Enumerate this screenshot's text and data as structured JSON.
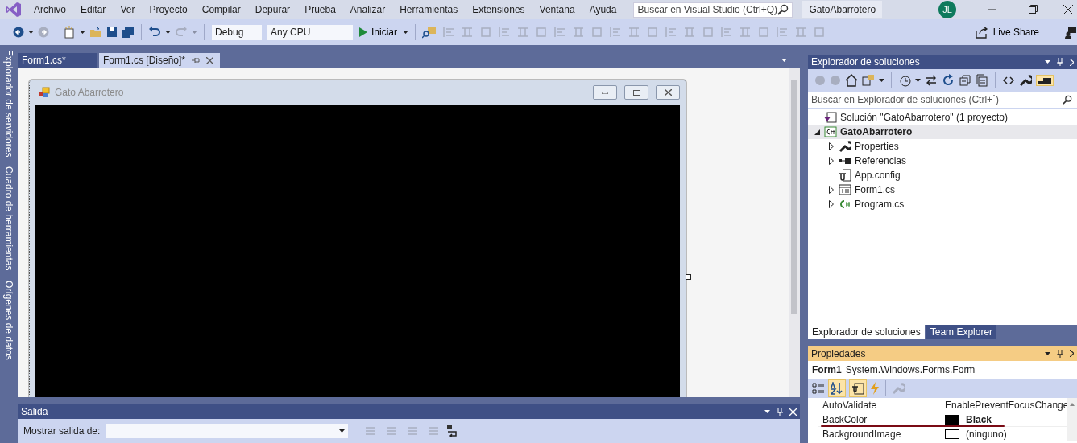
{
  "menu": [
    "Archivo",
    "Editar",
    "Ver",
    "Proyecto",
    "Compilar",
    "Depurar",
    "Prueba",
    "Analizar",
    "Herramientas",
    "Extensiones",
    "Ventana",
    "Ayuda"
  ],
  "search": {
    "placeholder": "Buscar en Visual Studio (Ctrl+Q)"
  },
  "project_title": "GatoAbarrotero",
  "avatar": "JL",
  "toolbar": {
    "configuration": "Debug",
    "platform": "Any CPU",
    "start": "Iniciar",
    "live_share": "Live Share"
  },
  "side_tabs": [
    "Explorador de servidores",
    "Cuadro de herramientas",
    "Orígenes de datos"
  ],
  "doc_tabs": [
    {
      "label": "Form1.cs*",
      "selected": false
    },
    {
      "label": "Form1.cs [Diseño]*",
      "selected": true
    }
  ],
  "designer": {
    "form_title": "Gato Abarrotero",
    "color": "#000000"
  },
  "output": {
    "title": "Salida",
    "show_label": "Mostrar salida de:"
  },
  "solution_explorer": {
    "title": "Explorador de soluciones",
    "search_placeholder": "Buscar en Explorador de soluciones (Ctrl+´)",
    "preview_selected": true,
    "tree": [
      {
        "label": "Solución \"GatoAbarrotero\"  (1 proyecto)",
        "kind": "solution",
        "expandable": false,
        "selected": false,
        "children": [
          {
            "label": "GatoAbarrotero",
            "kind": "project",
            "expandable": true,
            "expanded": true,
            "selected": true,
            "children": [
              {
                "label": "Properties",
                "kind": "wrench",
                "expandable": true,
                "expanded": false,
                "selected": false
              },
              {
                "label": "Referencias",
                "kind": "references",
                "expandable": true,
                "expanded": false,
                "selected": false
              },
              {
                "label": "App.config",
                "kind": "config",
                "expandable": false,
                "selected": false
              },
              {
                "label": "Form1.cs",
                "kind": "form",
                "expandable": true,
                "expanded": false,
                "selected": false
              },
              {
                "label": "Program.cs",
                "kind": "csharp",
                "expandable": true,
                "expanded": false,
                "selected": false
              }
            ]
          }
        ]
      }
    ]
  },
  "panel_tabs": [
    {
      "label": "Explorador de soluciones",
      "selected": true
    },
    {
      "label": "Team Explorer",
      "selected": false
    }
  ],
  "properties": {
    "title": "Propiedades",
    "object_name": "Form1",
    "object_type": "System.Windows.Forms.Form",
    "alphabetical_selected": true,
    "properties_view_selected": true,
    "rows": [
      {
        "name": "AutoValidate",
        "value": "EnablePreventFocusChange",
        "modified": false
      },
      {
        "name": "BackColor",
        "value": "Black",
        "modified": true,
        "color": "#000000"
      },
      {
        "name": "BackgroundImage",
        "value": "(ninguno)",
        "modified": false,
        "color": "#ffffff"
      }
    ]
  }
}
